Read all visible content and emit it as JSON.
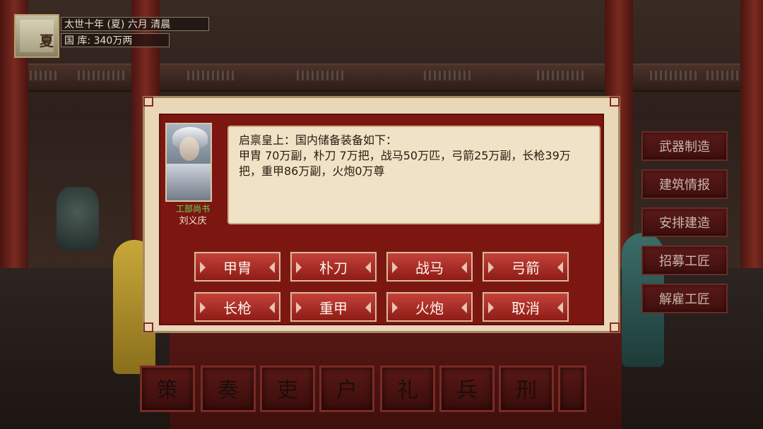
{
  "status": {
    "date_line": "太世十年 (夏) 六月 清晨",
    "treasury_line": "国 库: 340万两",
    "dynasty_glyph": "夏"
  },
  "dialog": {
    "official_title": "工部尚书",
    "official_name": "刘义庆",
    "message_line1": "启禀皇上：国内储备装备如下：",
    "message_line2": "甲胄 70万副，朴刀 7万把，战马50万匹，弓箭25万副，长枪39万把，重甲86万副，火炮0万尊",
    "buttons": [
      "甲胄",
      "朴刀",
      "战马",
      "弓箭",
      "长枪",
      "重甲",
      "火炮",
      "取消"
    ]
  },
  "side_menu": [
    "武器制造",
    "建筑情报",
    "安排建造",
    "招募工匠",
    "解雇工匠"
  ],
  "ministries": [
    "策",
    "奏",
    "吏",
    "户",
    "礼",
    "兵",
    "刑"
  ],
  "colors": {
    "accent_red": "#8e1c16",
    "official_title_green": "#5fe05a",
    "dialog_parchment": "#ead7b8"
  }
}
